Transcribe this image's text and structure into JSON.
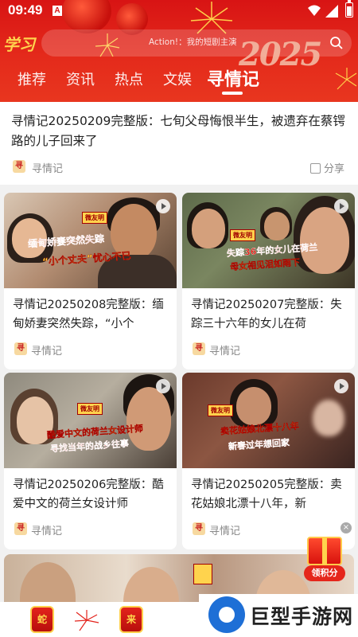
{
  "status_bar": {
    "time": "09:49",
    "notification_glyph": "A"
  },
  "header": {
    "logo_text": "学习",
    "search_placeholder": "Action!：我的短剧主演",
    "year_art": "2025",
    "tabs": [
      "推荐",
      "资讯",
      "热点",
      "文娱",
      "寻情记"
    ],
    "active_tab_index": 4
  },
  "top_article": {
    "title": "寻情记20250209完整版：七旬父母悔恨半生，被遗弃在蔡锷路的儿子回来了",
    "source": "寻情记",
    "share_label": "分享"
  },
  "cards": [
    {
      "title": "寻情记20250208完整版：缅甸娇妻突然失踪，“小个",
      "source": "寻情记",
      "thumb_caption_1": "缅甸娇妻突然失踪",
      "thumb_caption_2": "“小个丈夫”忧心不已"
    },
    {
      "title": "寻情记20250207完整版：失踪三十六年的女儿在荷",
      "source": "寻情记",
      "thumb_caption_1": "失踪36年的女儿在荷兰",
      "thumb_caption_2": "母女相见泪如雨下"
    },
    {
      "title": "寻情记20250206完整版：酷爱中文的荷兰女设计师",
      "source": "寻情记",
      "thumb_caption_1": "酷爱中文的荷兰女设计师",
      "thumb_caption_2": "寻找当年的战乡往事"
    },
    {
      "title": "寻情记20250205完整版：卖花姑娘北漂十八年，新",
      "source": "寻情记",
      "thumb_caption_1": "卖花姑娘北漂十八年",
      "thumb_caption_2": "新春过年想回家"
    }
  ],
  "thumb_stamp": "微友明",
  "source_icon_glyph": "寻",
  "points_widget": {
    "label": "领积分",
    "close_glyph": "×"
  },
  "bottom_bar": {
    "icon_1": "蛇",
    "icon_2": "来"
  },
  "watermark": {
    "text": "巨型手游网"
  },
  "colors": {
    "brand_red": "#d81414",
    "text_dark": "#222222",
    "text_muted": "#888888"
  }
}
